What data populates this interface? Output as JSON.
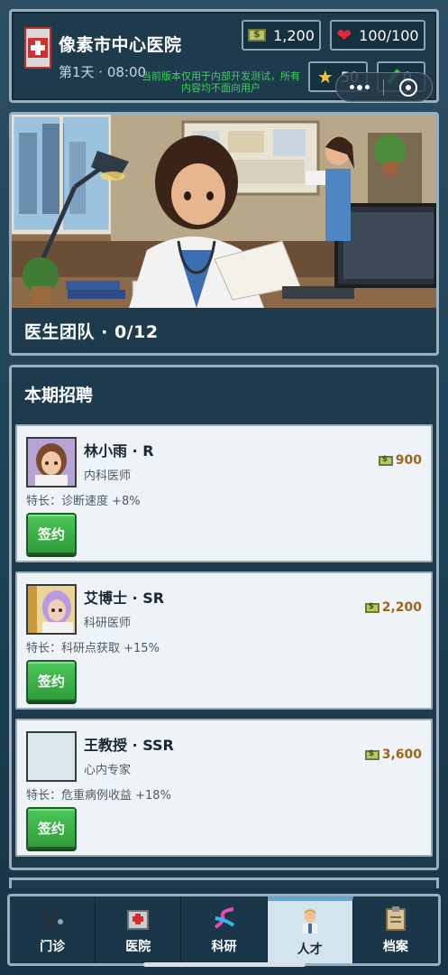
{
  "header": {
    "hospital_name": "像素市中心医院",
    "day_time": "第1天 · 08:00",
    "money": "1,200",
    "health": "100/100",
    "stars": "50",
    "research": "0",
    "dev_notice": "当前版本仅用于内部开发测试，所有内容均不面向用户"
  },
  "banner": {
    "title": "医生团队 · 0/12"
  },
  "recruit": {
    "title": "本期招聘",
    "sign_label": "签约",
    "candidates": [
      {
        "name": "林小雨 · R",
        "role": "内科医师",
        "specialty": "特长：诊断速度 +8%",
        "price": "900"
      },
      {
        "name": "艾博士 · SR",
        "role": "科研医师",
        "specialty": "特长：科研点获取 +15%",
        "price": "2,200"
      },
      {
        "name": "王教授 · SSR",
        "role": "心内专家",
        "specialty": "特长：危重病例收益 +18%",
        "price": "3,600"
      }
    ]
  },
  "nav": {
    "items": [
      {
        "label": "门诊",
        "icon": "stethoscope-icon"
      },
      {
        "label": "医院",
        "icon": "hospital-icon"
      },
      {
        "label": "科研",
        "icon": "dna-icon"
      },
      {
        "label": "人才",
        "icon": "doctor-icon"
      },
      {
        "label": "档案",
        "icon": "clipboard-icon"
      }
    ],
    "active": "人才"
  },
  "colors": {
    "panel": "#1e3b4e",
    "border": "#9aafbd",
    "accent_green": "#3fb04a",
    "price": "#a0661a",
    "active_tab": "#d3e4ee"
  }
}
